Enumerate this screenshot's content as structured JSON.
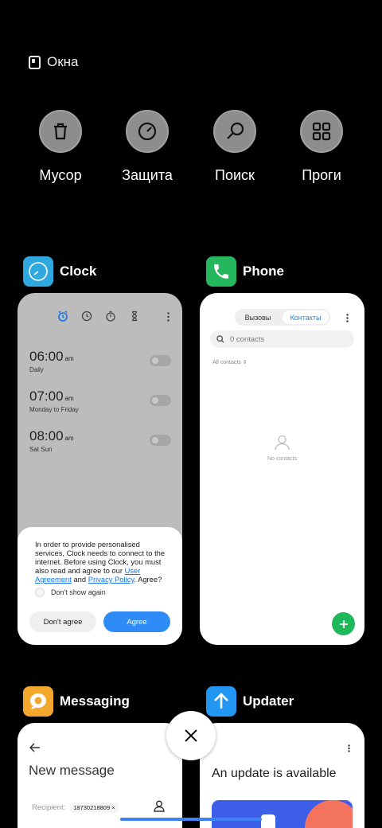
{
  "header": {
    "title": "Окна"
  },
  "quick_actions": [
    {
      "label": "Мусор",
      "icon": "trash-icon"
    },
    {
      "label": "Защита",
      "icon": "shield-gauge-icon"
    },
    {
      "label": "Поиск",
      "icon": "search-icon"
    },
    {
      "label": "Проги",
      "icon": "apps-grid-icon"
    }
  ],
  "cards": {
    "clock": {
      "name": "Clock",
      "icon_color": "#2fa8e0",
      "alarms": [
        {
          "time": "06:00",
          "ampm": "am",
          "repeat": "Daily"
        },
        {
          "time": "07:00",
          "ampm": "am",
          "repeat": "Monday to Friday"
        },
        {
          "time": "08:00",
          "ampm": "am",
          "repeat": "Sat Sun"
        }
      ],
      "dialog": {
        "text": "In order to provide personalised services, Clock needs to connect to the internet. Before using Clock, you must also read and agree to our ",
        "link1": "User Agreement",
        "and": " and ",
        "link2": "Privacy Policy",
        "end": ". Agree?",
        "checkbox_label": "Don't show again",
        "disagree": "Don't agree",
        "agree": "Agree"
      }
    },
    "phone": {
      "name": "Phone",
      "icon_color": "#25b75d",
      "tabs": [
        "Вызовы",
        "Контакты"
      ],
      "search_placeholder": "0 contacts",
      "filter": "All contacts",
      "empty": "No contacts"
    },
    "messaging": {
      "name": "Messaging",
      "icon_color": "#f3a72d",
      "title": "New message",
      "recipient_label": "Recipient:",
      "recipient_chip": "18730218809 ×"
    },
    "updater": {
      "name": "Updater",
      "icon_color": "#2196f3",
      "title": "An update is available"
    }
  },
  "colors": {
    "accent": "#2f8cf6",
    "home_bar": "#3b82f6"
  }
}
